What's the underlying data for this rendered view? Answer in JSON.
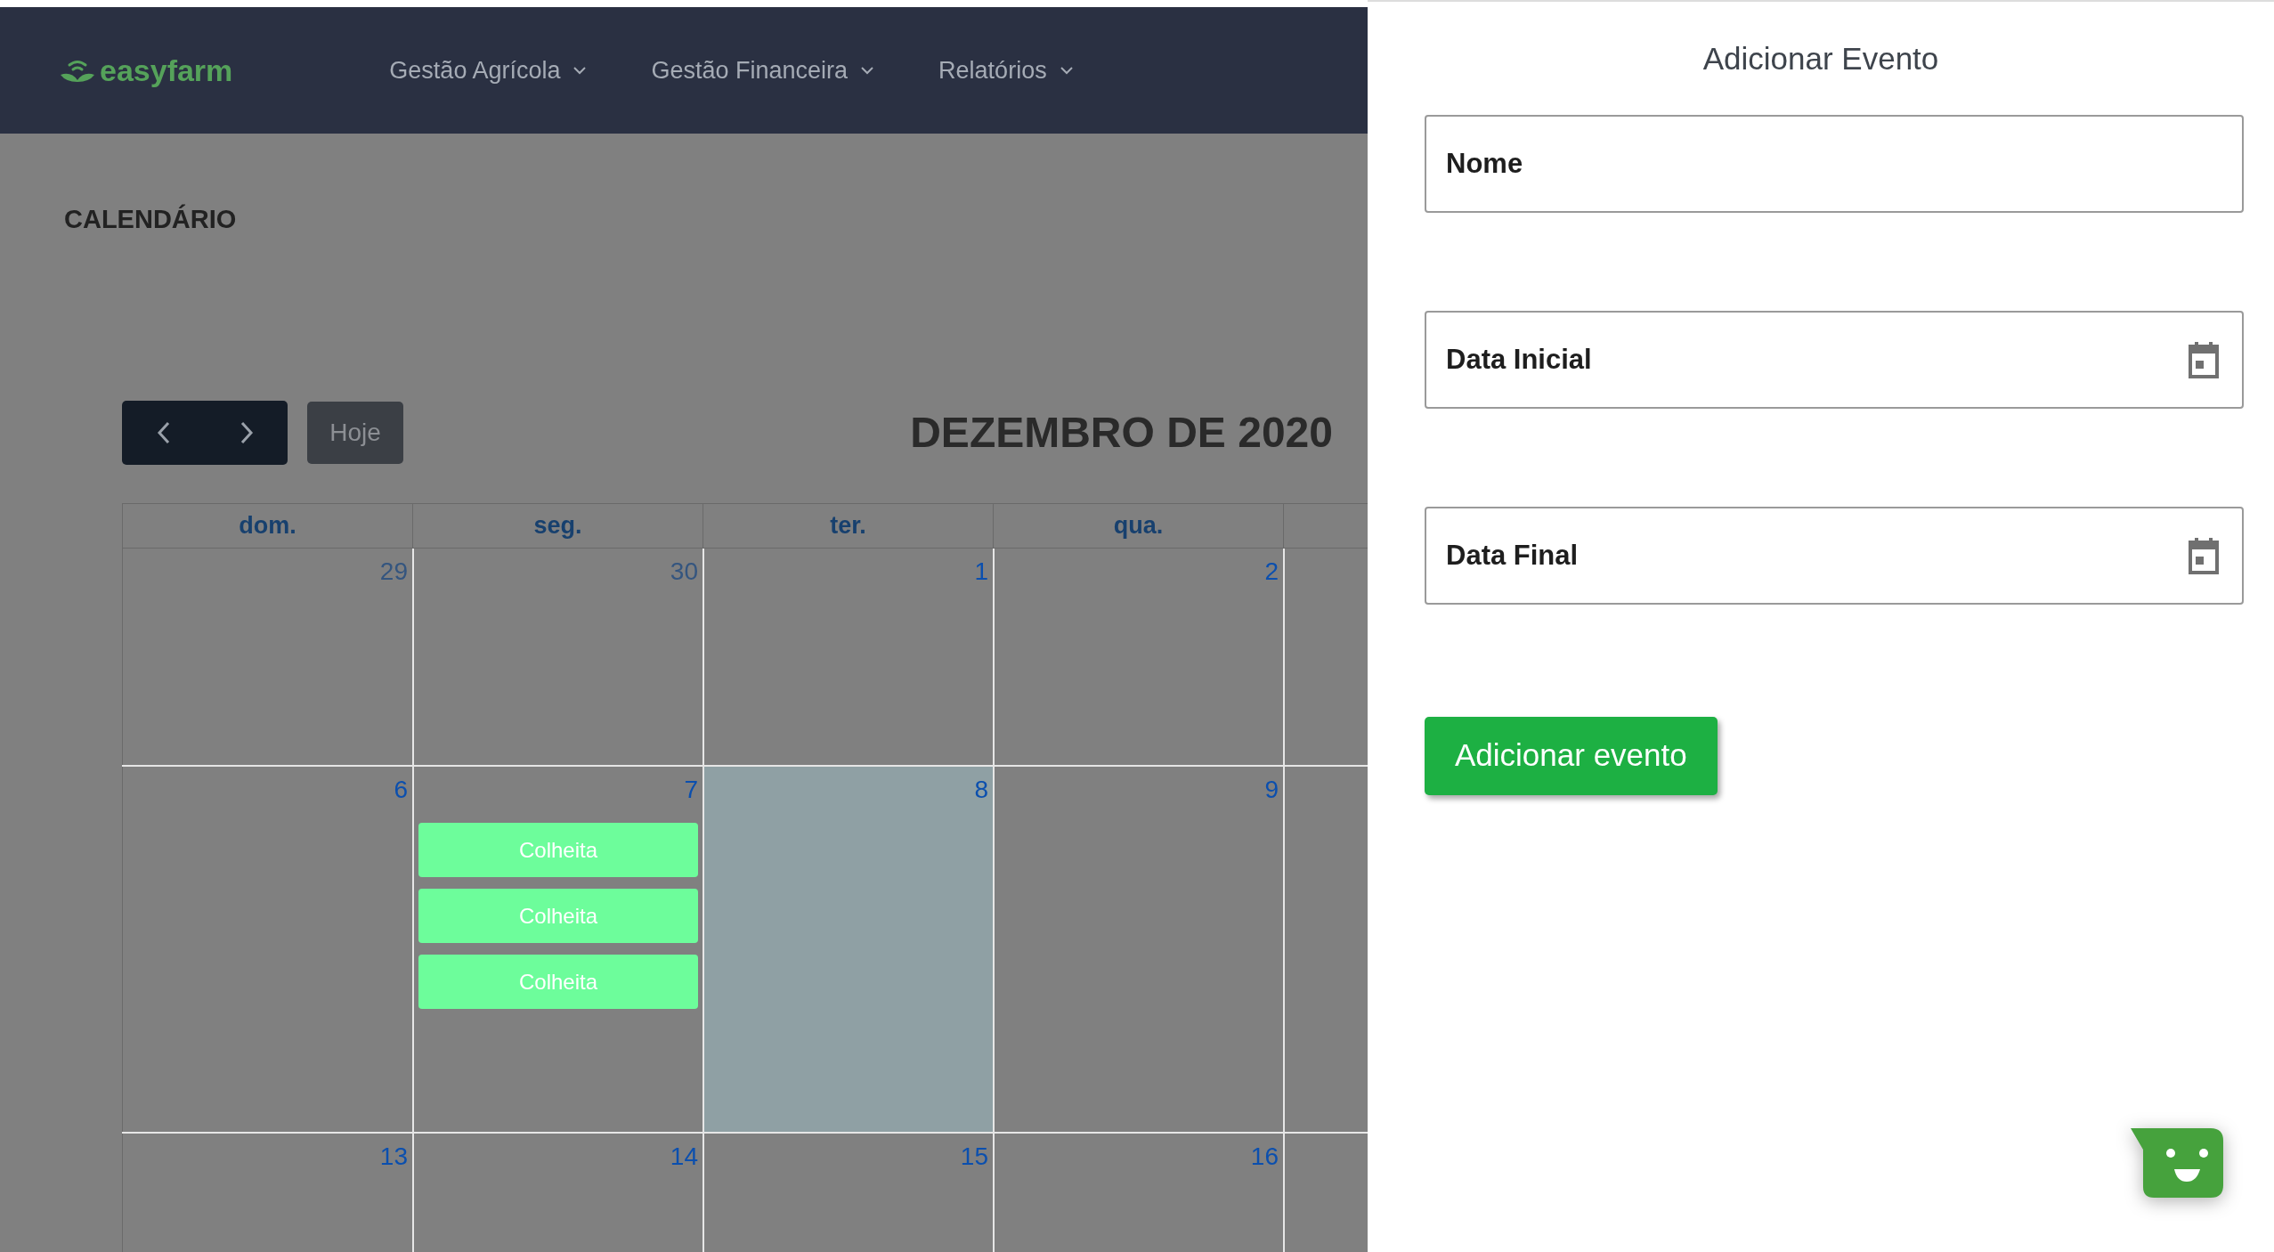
{
  "header": {
    "logo": "easyfarm",
    "menu": [
      {
        "label": "Gestão Agrícola"
      },
      {
        "label": "Gestão Financeira"
      },
      {
        "label": "Relatórios"
      }
    ]
  },
  "page_title": "CALENDÁRIO",
  "calendar": {
    "today_button": "Hoje",
    "month_title": "DEZEMBRO DE 2020",
    "weekdays": [
      "dom.",
      "seg.",
      "ter.",
      "qua."
    ],
    "weeks": [
      [
        {
          "day": "29",
          "other_month": true,
          "selected": false
        },
        {
          "day": "30",
          "other_month": true,
          "selected": false
        },
        {
          "day": "1",
          "other_month": false,
          "selected": false
        },
        {
          "day": "2",
          "other_month": false,
          "selected": false
        }
      ],
      [
        {
          "day": "6",
          "other_month": false,
          "selected": false
        },
        {
          "day": "7",
          "other_month": false,
          "selected": false,
          "events": [
            "Colheita",
            "Colheita",
            "Colheita"
          ]
        },
        {
          "day": "8",
          "other_month": false,
          "selected": true
        },
        {
          "day": "9",
          "other_month": false,
          "selected": false
        }
      ],
      [
        {
          "day": "13",
          "other_month": false,
          "selected": false
        },
        {
          "day": "14",
          "other_month": false,
          "selected": false
        },
        {
          "day": "15",
          "other_month": false,
          "selected": false
        },
        {
          "day": "16",
          "other_month": false,
          "selected": false
        }
      ]
    ]
  },
  "panel": {
    "title": "Adicionar Evento",
    "fields": [
      {
        "placeholder": "Nome",
        "kind": "text"
      },
      {
        "placeholder": "Data Inicial",
        "kind": "date"
      },
      {
        "placeholder": "Data Final",
        "kind": "date"
      }
    ],
    "submit": "Adicionar evento"
  }
}
